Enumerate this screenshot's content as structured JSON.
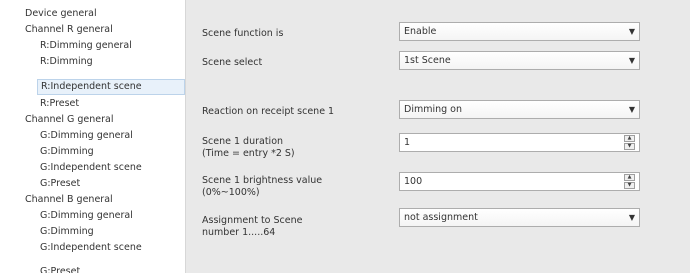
{
  "sidebar": {
    "items": [
      {
        "label": "Device general"
      },
      {
        "label": "Channel R general"
      },
      {
        "label": "R:Dimming general"
      },
      {
        "label": "R:Dimming"
      },
      {
        "label": "R:Independent scene"
      },
      {
        "label": "R:Preset"
      },
      {
        "label": "Channel G general"
      },
      {
        "label": "G:Dimming general"
      },
      {
        "label": "G:Dimming"
      },
      {
        "label": "G:Independent scene"
      },
      {
        "label": "G:Preset"
      },
      {
        "label": "Channel B general"
      },
      {
        "label": "G:Dimming general"
      },
      {
        "label": "G:Dimming"
      },
      {
        "label": "G:Independent scene"
      },
      {
        "label": "G:Preset"
      }
    ]
  },
  "form": {
    "scene_function": {
      "label": "Scene function is",
      "value": "Enable"
    },
    "scene_select": {
      "label": "Scene  select",
      "value": "1st Scene"
    },
    "reaction": {
      "label": "Reaction on receipt scene 1",
      "value": "Dimming on"
    },
    "duration": {
      "label": "Scene 1 duration",
      "sublabel": "(Time = entry *2 S)",
      "value": "1"
    },
    "brightness": {
      "label": "Scene 1 brightness value",
      "sublabel": "(0%~100%)",
      "value": "100"
    },
    "assignment": {
      "label": "Assignment to Scene",
      "sublabel": "number 1.....64",
      "value": "not assignment"
    }
  },
  "icons": {
    "dropdown_arrow": "chevron-down-icon",
    "spin_up": "spin-up-icon",
    "spin_down": "spin-down-icon"
  },
  "colors": {
    "selection_bg": "#e8f1fa",
    "selection_border": "#bcd3ea",
    "panel_bg": "#e9e9e9"
  }
}
